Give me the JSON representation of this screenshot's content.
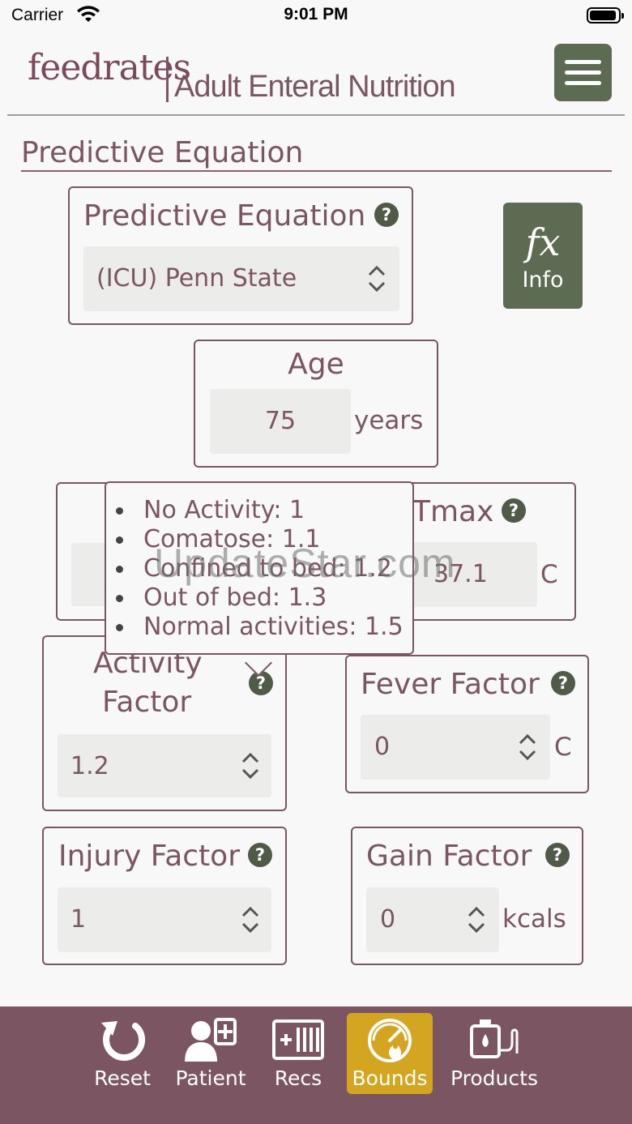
{
  "status_bar": {
    "carrier": "Carrier",
    "time": "9:01 PM"
  },
  "header": {
    "logo": "feedrates",
    "title": "Adult Enteral Nutrition"
  },
  "section_title": "Predictive Equation",
  "predictive_equation": {
    "label": "Predictive Equation",
    "value": "(ICU) Penn State"
  },
  "info_button": {
    "symbol": "fx",
    "label": "Info"
  },
  "age": {
    "label": "Age",
    "value": "75",
    "unit": "years"
  },
  "tmax": {
    "label": "Tmax",
    "value": "37.1",
    "unit": "C"
  },
  "activity_factor": {
    "label_line1": "Activity",
    "label_line2": "Factor",
    "value": "1.2"
  },
  "fever_factor": {
    "label": "Fever Factor",
    "value": "0",
    "unit": "C"
  },
  "injury_factor": {
    "label": "Injury Factor",
    "value": "1"
  },
  "gain_factor": {
    "label": "Gain Factor",
    "value": "0",
    "unit": "kcals"
  },
  "tooltip": {
    "items": [
      "No Activity: 1",
      "Comatose: 1.1",
      "Confined to bed: 1.2",
      "Out of bed: 1.3",
      "Normal activities: 1.5"
    ]
  },
  "watermark": "UpdateStar.com",
  "tabbar": {
    "tabs": [
      {
        "label": "Reset",
        "icon": "reset-icon"
      },
      {
        "label": "Patient",
        "icon": "patient-icon"
      },
      {
        "label": "Recs",
        "icon": "recs-icon"
      },
      {
        "label": "Bounds",
        "icon": "bounds-icon",
        "active": true
      },
      {
        "label": "Products",
        "icon": "products-icon"
      }
    ]
  },
  "colors": {
    "accent": "#7a5562",
    "button_green": "#5d6b53",
    "active_tab": "#d4a51e",
    "tabbar": "#7c5562"
  }
}
